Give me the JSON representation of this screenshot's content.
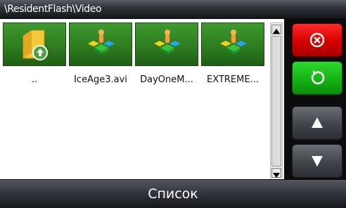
{
  "header": {
    "path": "\\ResidentFlash\\Video"
  },
  "files": [
    {
      "label": "..",
      "icon": "folder-up-icon"
    },
    {
      "label": "IceAge3.avi",
      "icon": "video-file-icon"
    },
    {
      "label": "DayOneM...",
      "icon": "video-file-icon"
    },
    {
      "label": "EXTREME...",
      "icon": "video-file-icon"
    }
  ],
  "buttons": {
    "close": "close-icon",
    "refresh": "refresh-icon",
    "up": "arrow-up-icon",
    "down": "arrow-down-icon"
  },
  "footer": {
    "title": "Список"
  },
  "colors": {
    "tile_green": "#2c7a1e",
    "close_red": "#d30000",
    "refresh_green": "#14b314",
    "nav_gray": "#41444b",
    "bar_dark": "#17181c"
  }
}
